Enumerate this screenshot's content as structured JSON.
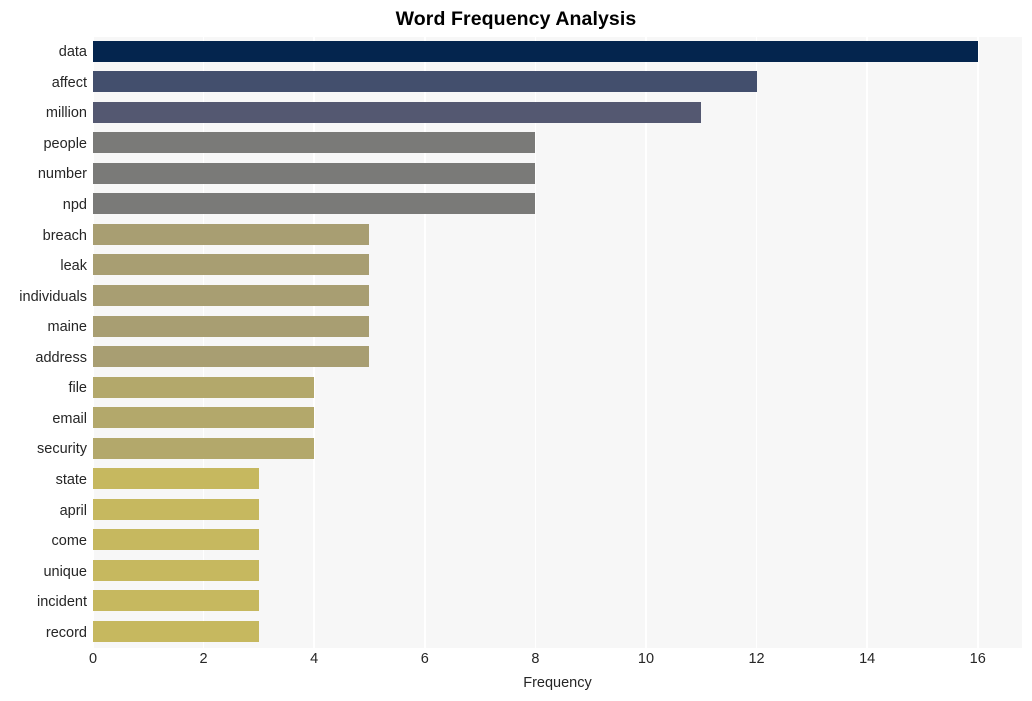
{
  "chart_data": {
    "type": "bar",
    "orientation": "horizontal",
    "title": "Word Frequency Analysis",
    "xlabel": "Frequency",
    "ylabel": "",
    "xlim": [
      0,
      16.8
    ],
    "xticks": [
      0,
      2,
      4,
      6,
      8,
      10,
      12,
      14,
      16
    ],
    "xtick_labels": [
      "0",
      "2",
      "4",
      "6",
      "8",
      "10",
      "12",
      "14",
      "16"
    ],
    "grid": "vertical-white-on-light-gray",
    "legend": "none",
    "categories": [
      "data",
      "affect",
      "million",
      "people",
      "number",
      "npd",
      "breach",
      "leak",
      "individuals",
      "maine",
      "address",
      "file",
      "email",
      "security",
      "state",
      "april",
      "come",
      "unique",
      "incident",
      "record"
    ],
    "values": [
      16,
      12,
      11,
      8,
      8,
      8,
      5,
      5,
      5,
      5,
      5,
      4,
      4,
      4,
      3,
      3,
      3,
      3,
      3,
      3
    ],
    "bar_colors": [
      "#04254e",
      "#434f6d",
      "#545871",
      "#7a7a78",
      "#7a7a78",
      "#7a7a78",
      "#a89e72",
      "#a89e72",
      "#a89e72",
      "#a89e72",
      "#a89e72",
      "#b3a86b",
      "#b3a86b",
      "#b3a86b",
      "#c6b85f",
      "#c6b85f",
      "#c6b85f",
      "#c6b85f",
      "#c6b85f",
      "#c6b85f"
    ]
  },
  "colors": {
    "figure_background": "#ffffff",
    "axes_background": "#f7f7f7",
    "gridline": "#ffffff",
    "tick_text": "#262626",
    "title_text": "#000000"
  }
}
